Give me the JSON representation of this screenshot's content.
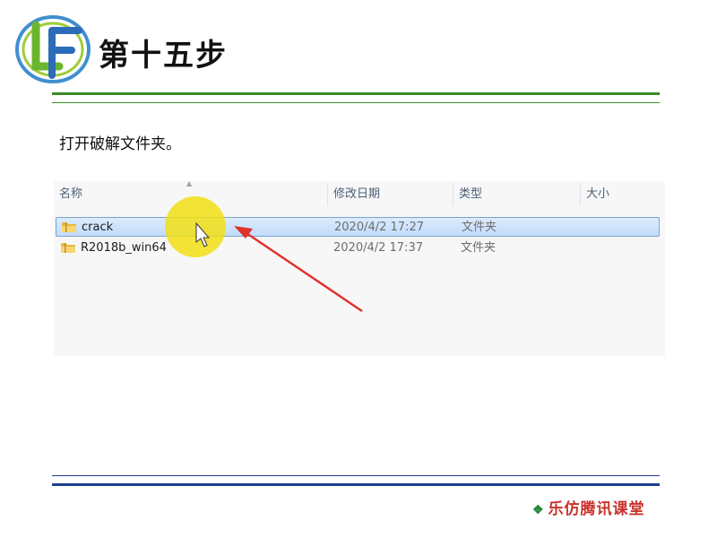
{
  "header": {
    "logo_text": "LF",
    "title": "第十五步"
  },
  "instruction": "打开破解文件夹。",
  "explorer": {
    "columns": {
      "name": "名称",
      "modified": "修改日期",
      "type": "类型",
      "size": "大小"
    },
    "rows": [
      {
        "name": "crack",
        "modified": "2020/4/2 17:27",
        "type": "文件夹",
        "selected": true,
        "icon": "folder-icon"
      },
      {
        "name": "R2018b_win64",
        "modified": "2020/4/2 17:37",
        "type": "文件夹",
        "selected": false,
        "icon": "folder-icon"
      }
    ]
  },
  "footer": {
    "icon": "diamond-cluster-icon",
    "text": "乐仿腾讯课堂"
  },
  "colors": {
    "top_rule": "#3a8a28",
    "bottom_rule": "#1f3f8f",
    "footer_text": "#c8322c",
    "highlight": "#f3e21a",
    "arrow": "#e0322c",
    "selection": "#c1dcfb"
  }
}
